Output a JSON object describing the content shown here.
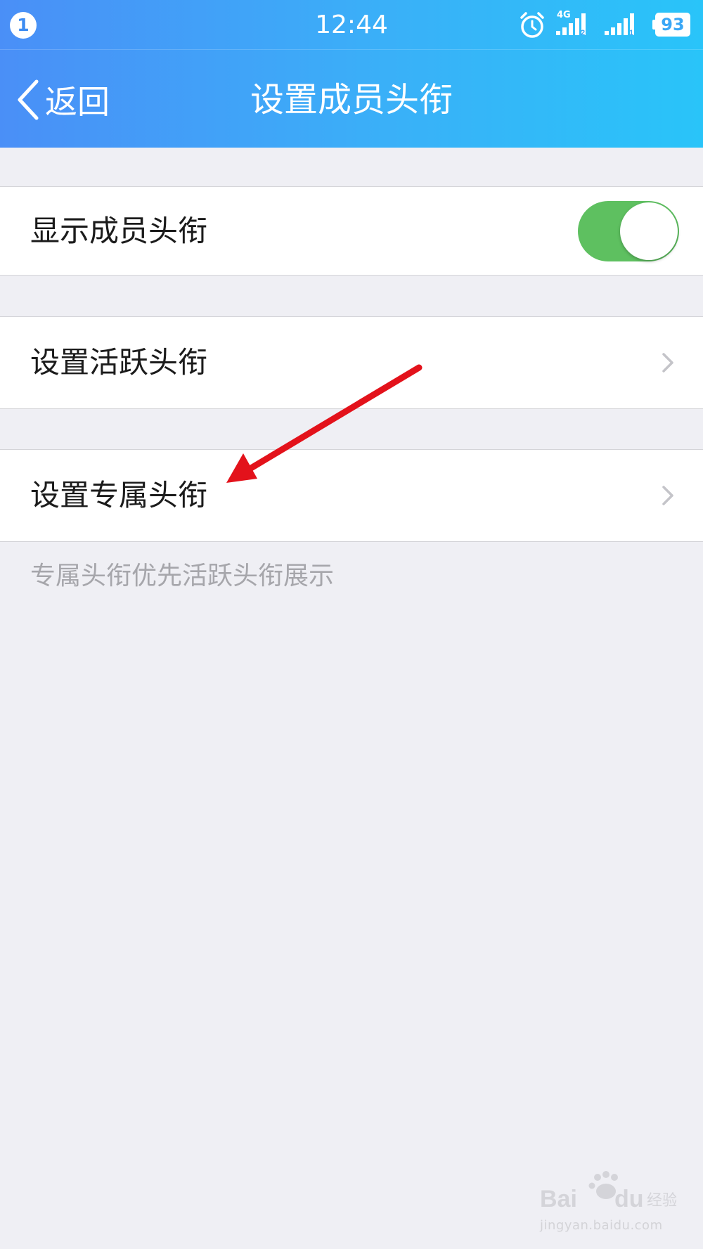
{
  "status_bar": {
    "notification_count": "1",
    "time": "12:44",
    "network_type": "4G",
    "sim_1": "2",
    "sim_2": "1",
    "battery_level": "93",
    "icons": [
      "alarm-clock-icon",
      "signal-icon",
      "signal-icon",
      "battery-icon"
    ]
  },
  "nav": {
    "back_label": "返回",
    "title": "设置成员头衔"
  },
  "settings": {
    "show_titles": {
      "label": "显示成员头衔",
      "enabled": true
    },
    "active_titles": {
      "label": "设置活跃头衔"
    },
    "exclusive_titles": {
      "label": "设置专属头衔"
    },
    "footnote": "专属头衔优先活跃头衔展示"
  },
  "watermark": {
    "url": "jingyan.baidu.com"
  },
  "colors": {
    "header_gradient_start": "#4a8ff7",
    "header_gradient_end": "#29c4f9",
    "toggle_on": "#5ec060",
    "background": "#efeff4",
    "annotation_arrow": "#e3121b"
  }
}
